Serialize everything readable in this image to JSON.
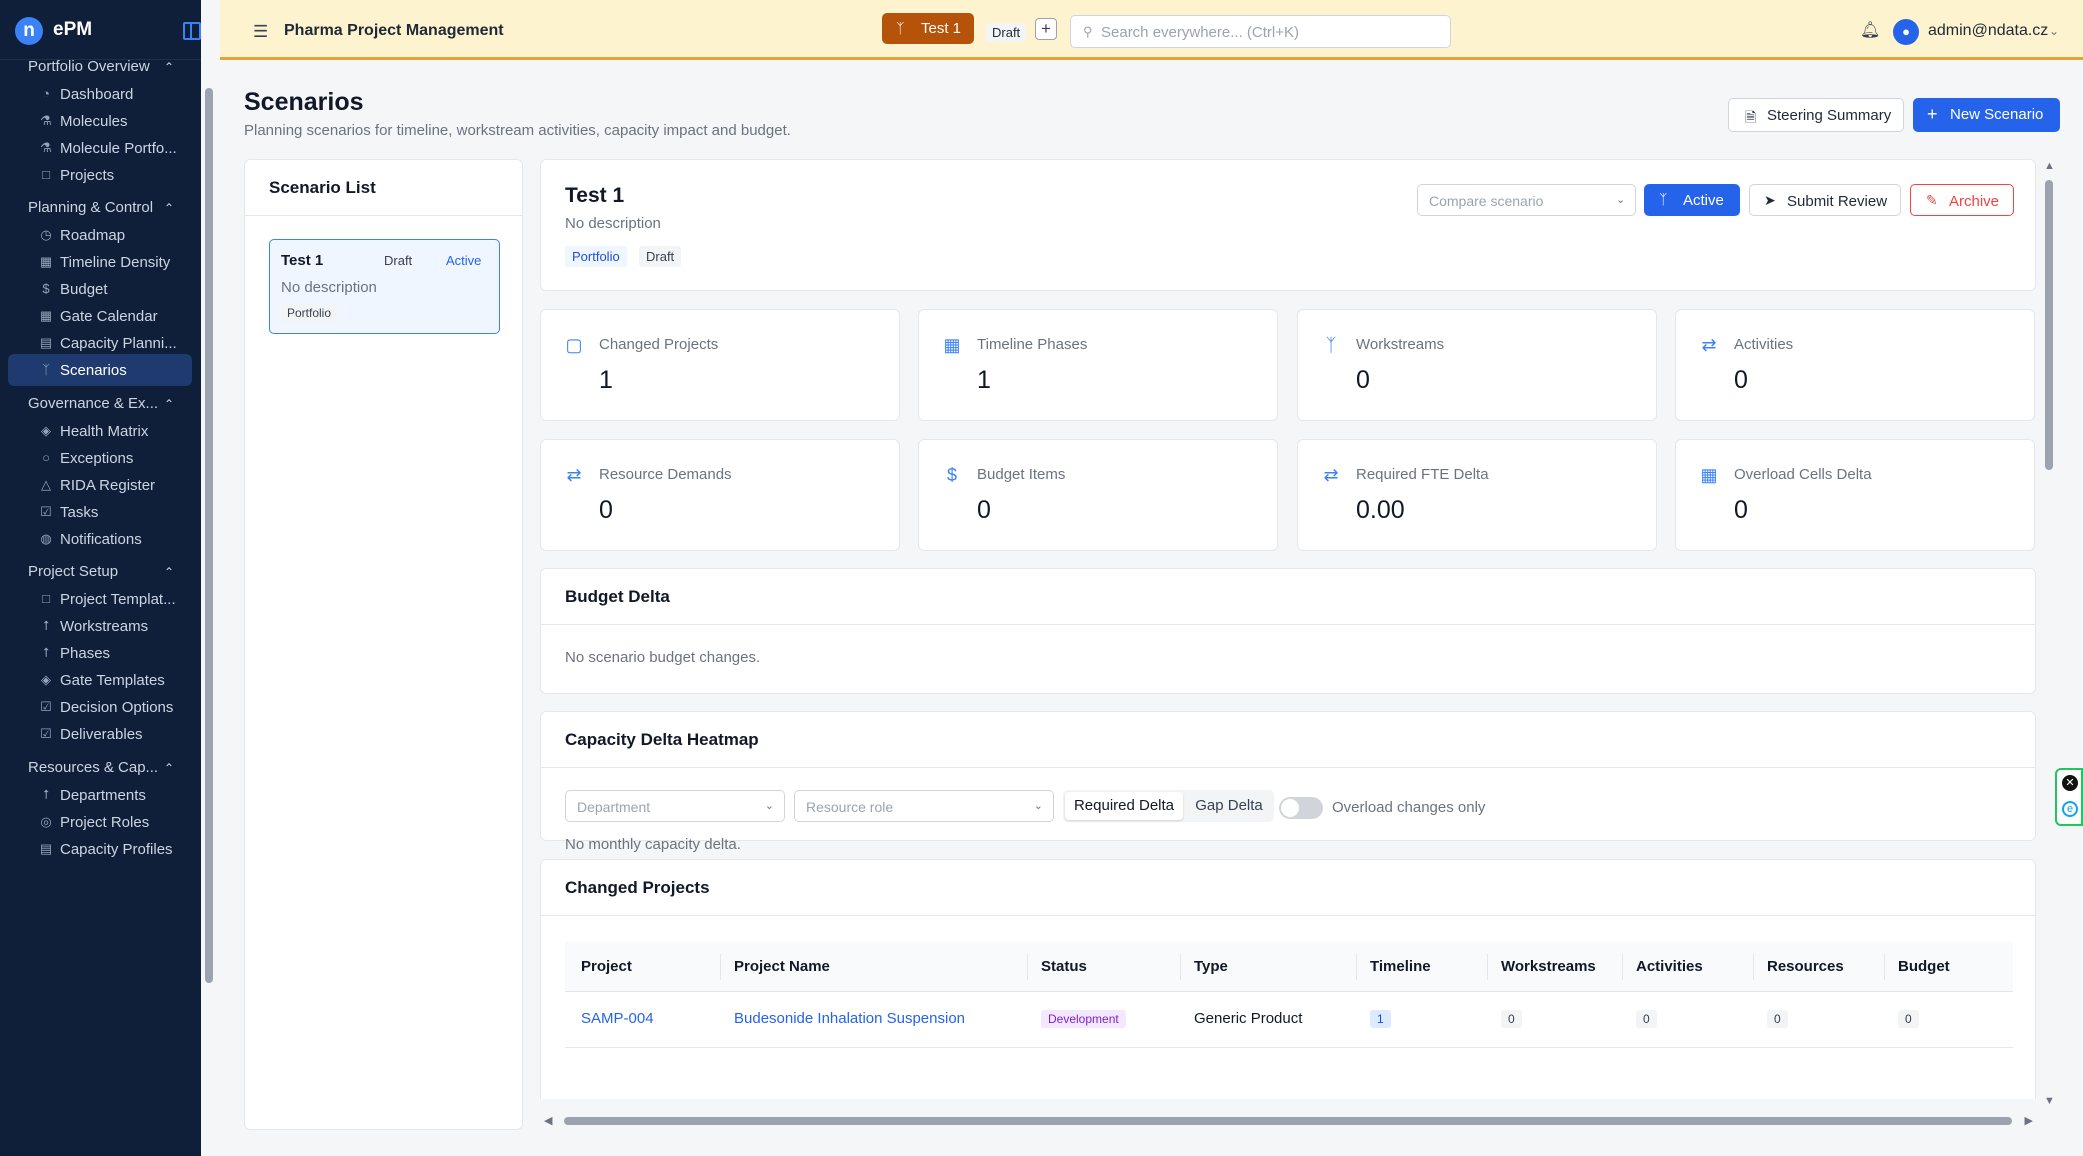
{
  "sidebar": {
    "app_name": "ePM",
    "logo_letter": "n",
    "groups": [
      {
        "label": "Portfolio Overview",
        "items": [
          {
            "label": "Dashboard",
            "icon": "gauge-icon"
          },
          {
            "label": "Molecules",
            "icon": "flask-icon"
          },
          {
            "label": "Molecule Portfo...",
            "icon": "flask-icon"
          },
          {
            "label": "Projects",
            "icon": "folder-icon"
          }
        ]
      },
      {
        "label": "Planning & Control",
        "items": [
          {
            "label": "Roadmap",
            "icon": "clock-icon"
          },
          {
            "label": "Timeline Density",
            "icon": "calendar-icon"
          },
          {
            "label": "Budget",
            "icon": "dollar-icon"
          },
          {
            "label": "Gate Calendar",
            "icon": "calendar-icon"
          },
          {
            "label": "Capacity Planni...",
            "icon": "chart-icon"
          },
          {
            "label": "Scenarios",
            "icon": "branch-icon",
            "active": true
          }
        ]
      },
      {
        "label": "Governance & Ex...",
        "items": [
          {
            "label": "Health Matrix",
            "icon": "shield-icon"
          },
          {
            "label": "Exceptions",
            "icon": "circle-icon"
          },
          {
            "label": "RIDA Register",
            "icon": "warning-icon"
          },
          {
            "label": "Tasks",
            "icon": "checkbox-icon"
          },
          {
            "label": "Notifications",
            "icon": "bell-icon"
          }
        ]
      },
      {
        "label": "Project Setup",
        "items": [
          {
            "label": "Project Templat...",
            "icon": "document-icon"
          },
          {
            "label": "Workstreams",
            "icon": "network-icon"
          },
          {
            "label": "Phases",
            "icon": "network-icon"
          },
          {
            "label": "Gate Templates",
            "icon": "shield-icon"
          },
          {
            "label": "Decision Options",
            "icon": "checkbox-icon"
          },
          {
            "label": "Deliverables",
            "icon": "checkbox-icon"
          }
        ]
      },
      {
        "label": "Resources & Cap...",
        "items": [
          {
            "label": "Departments",
            "icon": "network-icon"
          },
          {
            "label": "Project Roles",
            "icon": "user-icon"
          },
          {
            "label": "Capacity Profiles",
            "icon": "chart-icon"
          }
        ]
      }
    ]
  },
  "header": {
    "title": "Pharma Project Management",
    "scenario_button": "Test 1",
    "status": "Draft",
    "search_placeholder": "Search everywhere... (Ctrl+K)",
    "user": "admin@ndata.cz"
  },
  "page": {
    "title": "Scenarios",
    "subtitle": "Planning scenarios for timeline, workstream activities, capacity impact and budget.",
    "steering_button": "Steering Summary",
    "new_button": "New Scenario"
  },
  "list": {
    "title": "Scenario List",
    "items": [
      {
        "name": "Test 1",
        "status": "Draft",
        "state": "Active",
        "description": "No description",
        "tag": "Portfolio"
      }
    ]
  },
  "detail": {
    "name": "Test 1",
    "description": "No description",
    "tags": [
      "Portfolio",
      "Draft"
    ],
    "compare_placeholder": "Compare scenario",
    "active_button": "Active",
    "submit_button": "Submit Review",
    "archive_button": "Archive"
  },
  "stats": [
    {
      "label": "Changed Projects",
      "value": "1",
      "icon": "folder-open-icon"
    },
    {
      "label": "Timeline Phases",
      "value": "1",
      "icon": "calendar-icon"
    },
    {
      "label": "Workstreams",
      "value": "0",
      "icon": "branch-icon"
    },
    {
      "label": "Activities",
      "value": "0",
      "icon": "repeat-icon"
    },
    {
      "label": "Resource Demands",
      "value": "0",
      "icon": "repeat-icon"
    },
    {
      "label": "Budget Items",
      "value": "0",
      "icon": "dollar-icon"
    },
    {
      "label": "Required FTE Delta",
      "value": "0.00",
      "icon": "repeat-icon"
    },
    {
      "label": "Overload Cells Delta",
      "value": "0",
      "icon": "calendar-icon"
    }
  ],
  "budget_delta": {
    "title": "Budget Delta",
    "empty": "No scenario budget changes."
  },
  "capacity": {
    "title": "Capacity Delta Heatmap",
    "department_placeholder": "Department",
    "role_placeholder": "Resource role",
    "seg_required": "Required Delta",
    "seg_gap": "Gap Delta",
    "toggle_label": "Overload changes only",
    "empty": "No monthly capacity delta."
  },
  "changed_projects": {
    "title": "Changed Projects",
    "columns": [
      "Project",
      "Project Name",
      "Status",
      "Type",
      "Timeline",
      "Workstreams",
      "Activities",
      "Resources",
      "Budget"
    ],
    "rows": [
      {
        "project": "SAMP-004",
        "name": "Budesonide Inhalation Suspension",
        "status": "Development",
        "type": "Generic Product",
        "timeline": "1",
        "workstreams": "0",
        "activities": "0",
        "resources": "0",
        "budget": "0"
      }
    ]
  },
  "colors": {
    "sidebar_bg": "#0f1f3a",
    "header_bg": "#fdf3cf",
    "accent": "#2563eb",
    "scenario_button": "#b45309",
    "danger": "#ef4444"
  }
}
